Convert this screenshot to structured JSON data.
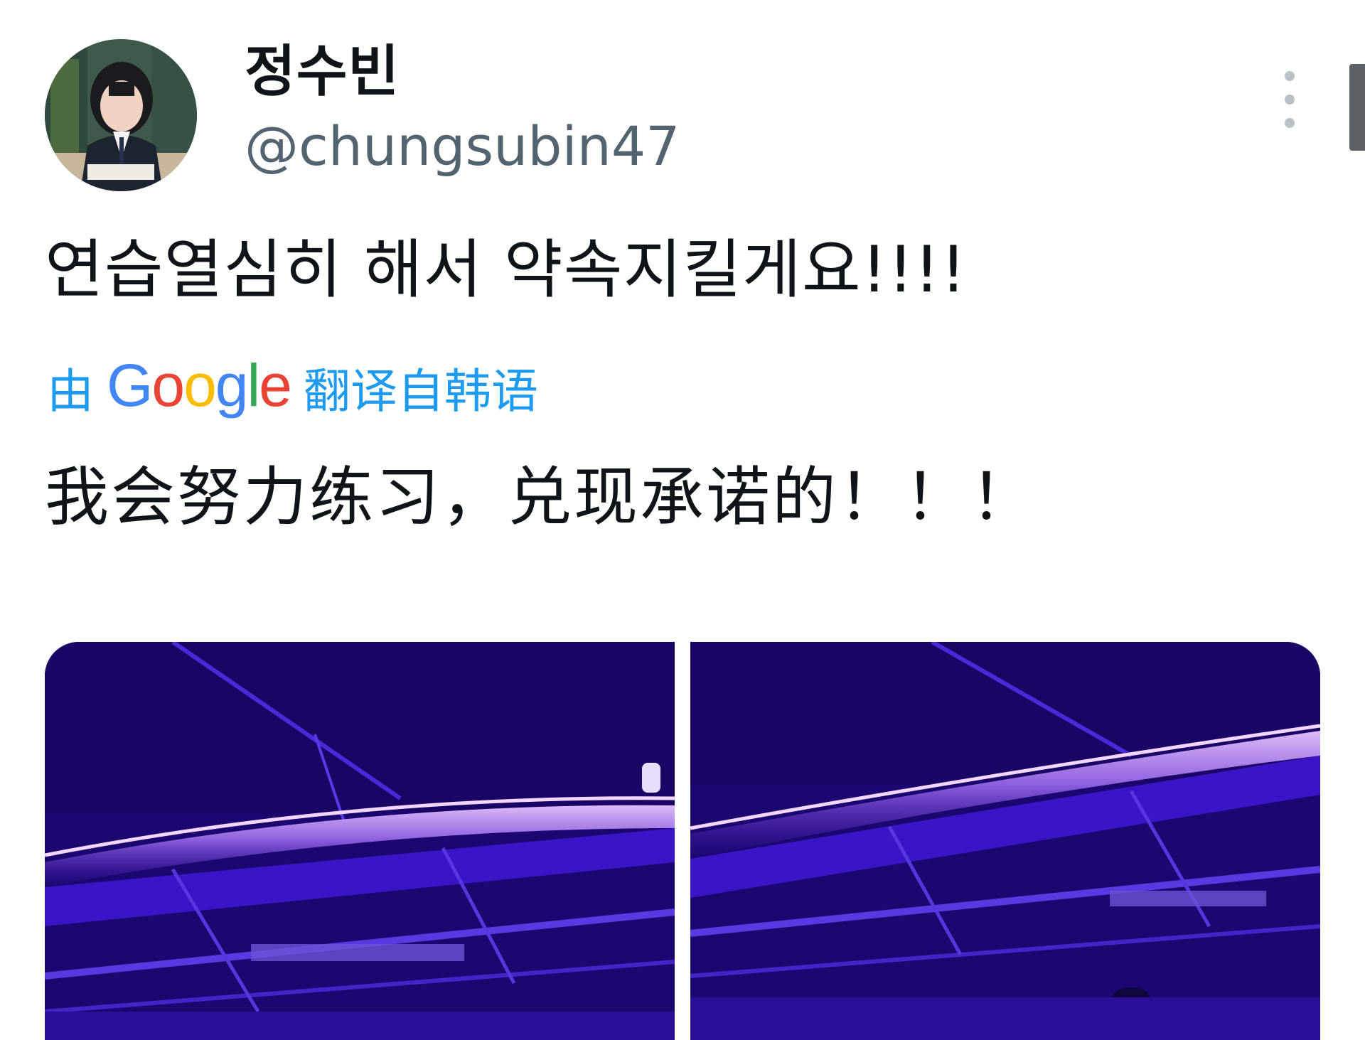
{
  "author": {
    "display_name": "정수빈",
    "handle": "@chungsubin47",
    "avatar_icon": "profile-photo"
  },
  "tweet": {
    "text": "연습열심히 해서 약속지킬게요!!!!",
    "translation": {
      "prefix": "由",
      "provider_letters": [
        "G",
        "o",
        "o",
        "g",
        "l",
        "e"
      ],
      "suffix": "翻译自韩语",
      "text": "我会努力练习，兑现承诺的！！！"
    },
    "media": [
      {
        "name": "photo-1",
        "theme": "purple-neon-ceiling"
      },
      {
        "name": "photo-2",
        "theme": "purple-neon-ceiling"
      }
    ]
  },
  "icons": {
    "more": "more-vertical-icon"
  },
  "colors": {
    "link": "#1d9bf0",
    "secondary_text": "#536471",
    "google_blue": "#4285f4",
    "google_red": "#ea4335",
    "google_yellow": "#fbbc05",
    "google_green": "#34a853",
    "neon_purple": "#b07cff"
  }
}
